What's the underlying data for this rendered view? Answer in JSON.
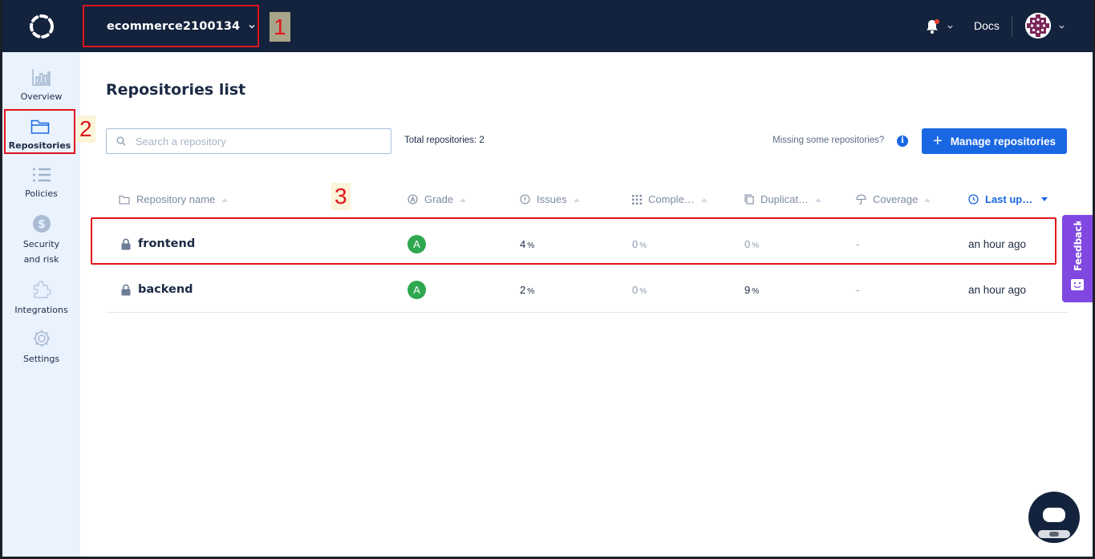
{
  "topbar": {
    "org_name": "ecommerce2100134",
    "docs_label": "Docs"
  },
  "annotations": {
    "one": "1",
    "two": "2",
    "three": "3"
  },
  "sidebar": {
    "items": [
      {
        "label": "Overview",
        "icon": "bar-chart-icon"
      },
      {
        "label": "Repositories",
        "icon": "folder-icon"
      },
      {
        "label": "Policies",
        "icon": "list-icon"
      },
      {
        "label": "Security",
        "label2": "and risk",
        "icon": "dollar-shield-icon"
      },
      {
        "label": "Integrations",
        "icon": "puzzle-icon"
      },
      {
        "label": "Settings",
        "icon": "gear-icon"
      }
    ]
  },
  "main": {
    "title": "Repositories list",
    "search_placeholder": "Search a repository",
    "total": "Total repositories: 2",
    "missing": "Missing some repositories?",
    "manage_button": "Manage repositories",
    "columns": {
      "name": "Repository name",
      "grade": "Grade",
      "issues": "Issues",
      "complexity": "Comple…",
      "duplication": "Duplicat…",
      "coverage": "Coverage",
      "updated": "Last up…"
    },
    "rows": [
      {
        "name": "frontend",
        "grade": "A",
        "issues": "4",
        "complexity": "0",
        "duplication": "0",
        "coverage": "-",
        "updated": "an hour ago"
      },
      {
        "name": "backend",
        "grade": "A",
        "issues": "2",
        "complexity": "0",
        "duplication": "9",
        "coverage": "-",
        "updated": "an hour ago"
      }
    ],
    "pct": "%"
  },
  "feedback_label": "Feedback",
  "colors": {
    "topbar": "#14233d",
    "accent": "#1967e2",
    "grade_a": "#2fa74f",
    "feedback": "#8048e0",
    "sidebar": "#e9f2fd",
    "annotation": "#e0141b"
  }
}
